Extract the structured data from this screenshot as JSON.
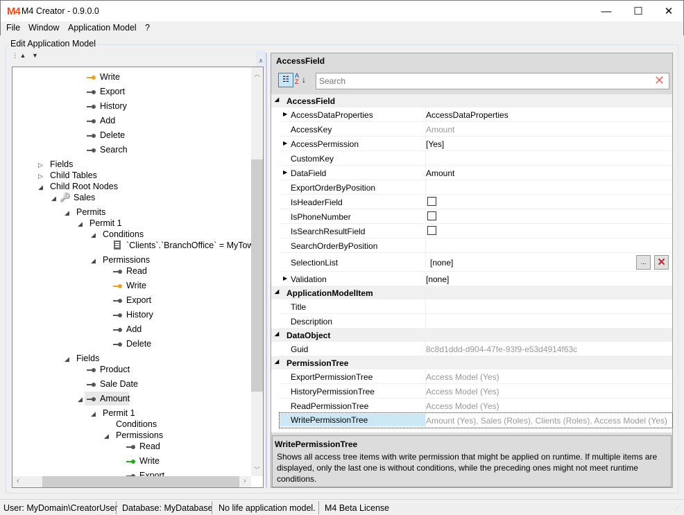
{
  "window": {
    "title": "M4 Creator - 0.9.0.0",
    "logo": "M4",
    "minimize": "—",
    "maximize": "☐",
    "close": "✕"
  },
  "menu": [
    "File",
    "Window",
    "Application Model",
    "?"
  ],
  "group_label": "Edit Application Model",
  "tree": [
    {
      "level": 4,
      "icon": "key",
      "color": "#f0a020",
      "label": "Write"
    },
    {
      "level": 4,
      "icon": "key",
      "label": "Export"
    },
    {
      "level": 4,
      "icon": "key",
      "label": "History"
    },
    {
      "level": 4,
      "icon": "key",
      "label": "Add"
    },
    {
      "level": 4,
      "icon": "key",
      "label": "Delete"
    },
    {
      "level": 4,
      "icon": "key",
      "label": "Search"
    },
    {
      "level": 1,
      "arrow": "collapsed",
      "label": "Fields"
    },
    {
      "level": 1,
      "arrow": "collapsed",
      "label": "Child Tables"
    },
    {
      "level": 1,
      "arrow": "expanded",
      "label": "Child Root Nodes"
    },
    {
      "level": 2,
      "arrow": "expanded",
      "icon": "table",
      "label": "Sales"
    },
    {
      "level": 3,
      "arrow": "expanded",
      "label": "Permits"
    },
    {
      "level": 4,
      "arrow": "expanded",
      "label": "Permit 1"
    },
    {
      "level": 5,
      "arrow": "expanded",
      "label": "Conditions"
    },
    {
      "level": 6,
      "icon": "doc",
      "label": "`Clients`.`BranchOffice` = MyTown"
    },
    {
      "level": 5,
      "arrow": "expanded",
      "label": "Permissions"
    },
    {
      "level": 6,
      "icon": "key",
      "label": "Read"
    },
    {
      "level": 6,
      "icon": "key",
      "color": "#f0a020",
      "label": "Write"
    },
    {
      "level": 6,
      "icon": "key",
      "label": "Export"
    },
    {
      "level": 6,
      "icon": "key",
      "label": "History"
    },
    {
      "level": 6,
      "icon": "key",
      "label": "Add"
    },
    {
      "level": 6,
      "icon": "key",
      "label": "Delete"
    },
    {
      "level": 3,
      "arrow": "expanded",
      "label": "Fields"
    },
    {
      "level": 4,
      "icon": "key",
      "label": "Product"
    },
    {
      "level": 4,
      "icon": "key",
      "label": "Sale Date"
    },
    {
      "level": 4,
      "arrow": "expanded",
      "icon": "key",
      "label": "Amount",
      "selected": true
    },
    {
      "level": 5,
      "arrow": "expanded",
      "label": "Permit 1"
    },
    {
      "level": 6,
      "label": "Conditions"
    },
    {
      "level": 6,
      "arrow": "expanded",
      "label": "Permissions"
    },
    {
      "level": 7,
      "icon": "key",
      "label": "Read"
    },
    {
      "level": 7,
      "icon": "key",
      "color": "#22aa22",
      "label": "Write"
    },
    {
      "level": 7,
      "icon": "key",
      "label": "Export"
    }
  ],
  "props": {
    "header": "AccessField",
    "search_placeholder": "Search",
    "categories": [
      {
        "name": "AccessField",
        "rows": [
          {
            "name": "AccessDataProperties",
            "value": "AccessDataProperties",
            "expand": true
          },
          {
            "name": "AccessKey",
            "value": "Amount",
            "gray": true
          },
          {
            "name": "AccessPermission",
            "value": "[Yes]",
            "expand": true
          },
          {
            "name": "CustomKey",
            "value": ""
          },
          {
            "name": "DataField",
            "value": "Amount",
            "expand": true
          },
          {
            "name": "ExportOrderByPosition",
            "value": ""
          },
          {
            "name": "IsHeaderField",
            "checkbox": true
          },
          {
            "name": "IsPhoneNumber",
            "checkbox": true
          },
          {
            "name": "IsSearchResultField",
            "checkbox": true
          },
          {
            "name": "SearchOrderByPosition",
            "value": ""
          },
          {
            "name": "SelectionList",
            "value": "[none]",
            "buttons": true
          },
          {
            "name": "Validation",
            "value": "[none]",
            "expand": true
          }
        ]
      },
      {
        "name": "ApplicationModelItem",
        "rows": [
          {
            "name": "Title",
            "value": ""
          },
          {
            "name": "Description",
            "value": ""
          }
        ]
      },
      {
        "name": "DataObject",
        "rows": [
          {
            "name": "Guid",
            "value": "8c8d1ddd-d904-47fe-93f9-e53d4914f63c",
            "gray": true
          }
        ]
      },
      {
        "name": "PermissionTree",
        "rows": [
          {
            "name": "ExportPermissionTree",
            "value": "Access Model (Yes)",
            "gray": true
          },
          {
            "name": "HistoryPermissionTree",
            "value": "Access Model (Yes)",
            "gray": true
          },
          {
            "name": "ReadPermissionTree",
            "value": "Access Model (Yes)",
            "gray": true
          },
          {
            "name": "WritePermissionTree",
            "value": "Amount (Yes), Sales (Roles), Clients (Roles), Access Model (Yes)",
            "gray": true,
            "selected": true
          }
        ]
      }
    ],
    "ellipsis": "...",
    "desc_title": "WritePermissionTree",
    "desc_text": "Shows all access tree items with write permission that might be applied on runtime. If multiple items are displayed, only the last one is without conditions, while the preceding ones might not meet runtime conditions."
  },
  "status": [
    "User: MyDomain\\CreatorUser",
    "Database: MyDatabase",
    "No life application model.",
    "M4 Beta License"
  ]
}
